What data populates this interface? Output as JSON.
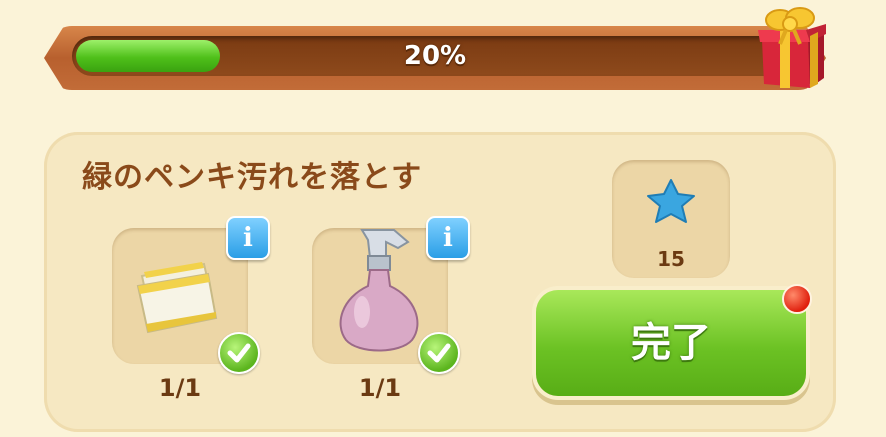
{
  "progress": {
    "label": "20%",
    "value": 0.2
  },
  "gift": {
    "icon": "gift-box-icon"
  },
  "task": {
    "title": "緑のペンキ汚れを落とす",
    "items": [
      {
        "icon": "cloth-icon",
        "count": "1/1",
        "completed": true
      },
      {
        "icon": "spray-bottle-icon",
        "count": "1/1",
        "completed": true
      }
    ]
  },
  "reward": {
    "icon": "blue-star-icon",
    "amount": "15"
  },
  "complete_button": {
    "label": "完了"
  },
  "colors": {
    "accent_green": "#6cc224",
    "brown_text": "#8a4a1a",
    "info_blue": "#2a9ee6"
  }
}
